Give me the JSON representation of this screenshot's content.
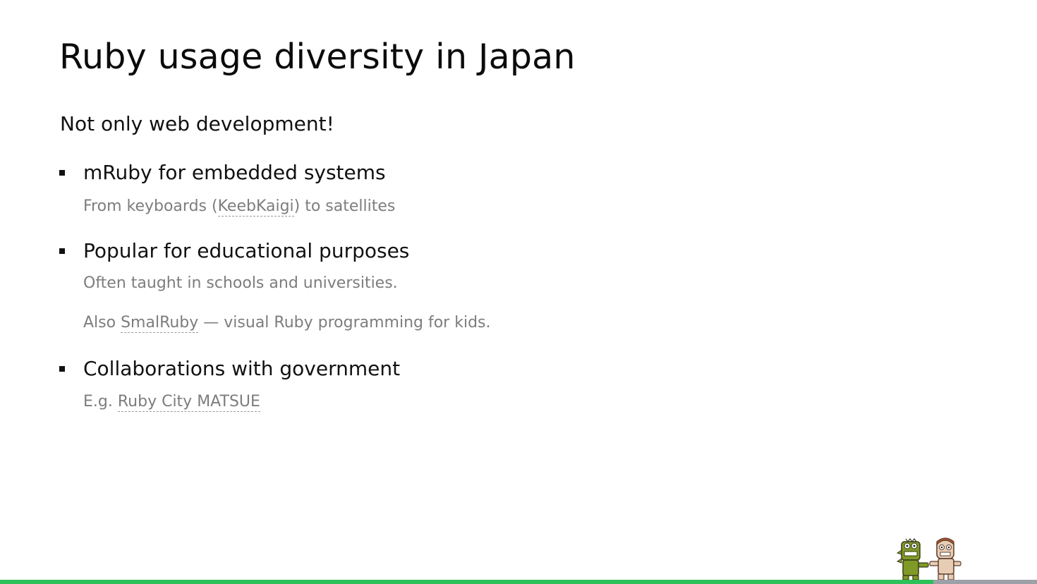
{
  "slide": {
    "title": "Ruby usage diversity in Japan",
    "subtitle": "Not only web development!",
    "items": [
      {
        "title": "mRuby for embedded systems",
        "notes": [
          {
            "before": "From keyboards (",
            "link": "KeebKaigi",
            "after": ") to satellites"
          }
        ]
      },
      {
        "title": "Popular for educational purposes",
        "notes": [
          {
            "text": "Often taught in schools and universities."
          },
          {
            "before": "Also ",
            "link": "SmalRuby",
            "after": " — visual Ruby programming for kids."
          }
        ]
      },
      {
        "title": "Collaborations with government",
        "notes": [
          {
            "before": "E.g. ",
            "link": "Ruby City MATSUE",
            "after": ""
          }
        ]
      }
    ]
  },
  "progress": {
    "fraction": 0.9
  },
  "mascots": {
    "icon": "mascots-illustration"
  },
  "colors": {
    "accent_green": "#2ec05a",
    "progress_gray": "#9ea0a8",
    "note_gray": "#7d7d7d",
    "mascot_green": "#7f9a26",
    "mascot_skin": "#e8cdb5",
    "mascot_hair": "#b5562a"
  }
}
